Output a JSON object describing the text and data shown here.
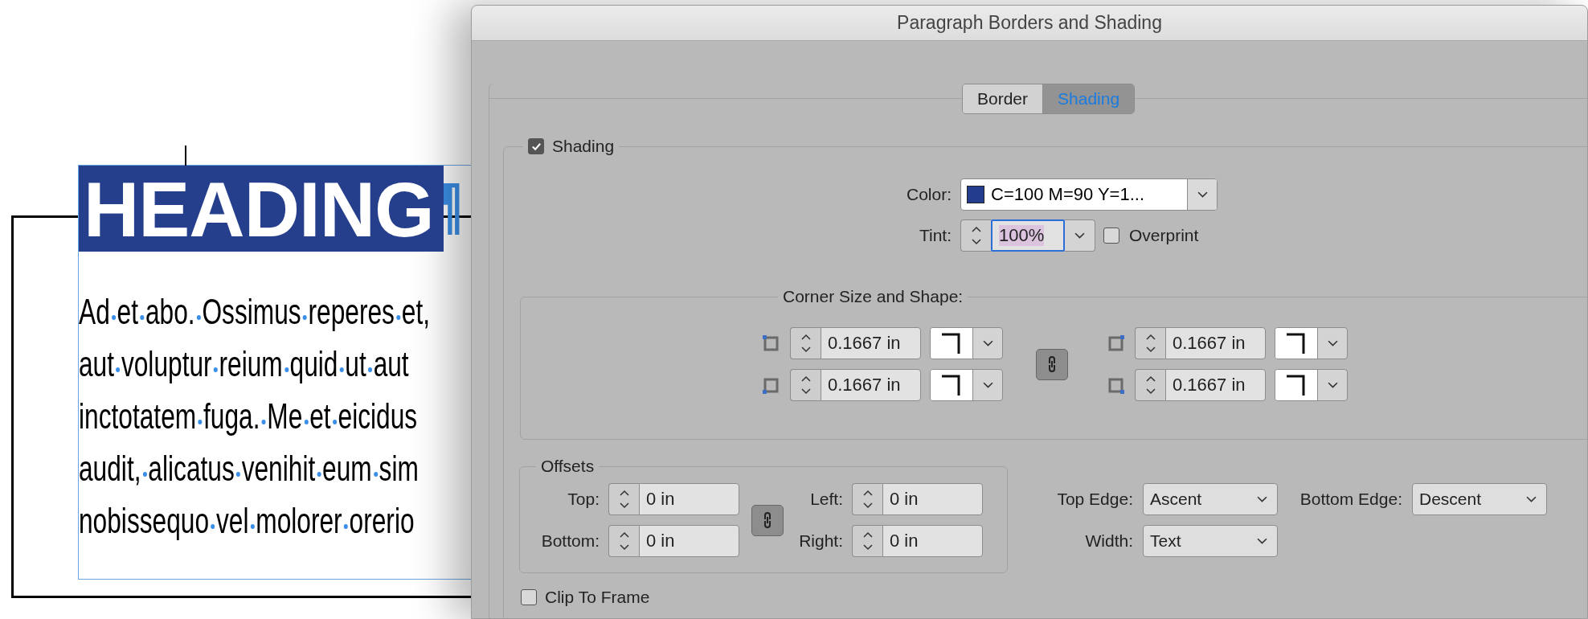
{
  "document": {
    "heading": "HEADING",
    "paragraph_lines": [
      "Ad et abo. Ossimus reperes et,",
      "aut voluptur reium quid ut aut",
      "inctotatem fuga. Me et eicidus",
      "audit, alicatus venihit eum sim",
      "nobissequo vel molorer orerio"
    ]
  },
  "dialog": {
    "title": "Paragraph Borders and Shading",
    "tabs": [
      {
        "label": "Border",
        "selected": false
      },
      {
        "label": "Shading",
        "selected": true
      }
    ],
    "shading": {
      "label": "Shading",
      "checked": true
    },
    "color": {
      "label": "Color:",
      "value": "C=100 M=90 Y=1..."
    },
    "tint": {
      "label": "Tint:",
      "value": "100%"
    },
    "overprint": {
      "label": "Overprint",
      "checked": false
    },
    "corners": {
      "title": "Corner Size and Shape:",
      "items": [
        {
          "kind": "top-left",
          "value": "0.1667 in"
        },
        {
          "kind": "top-right",
          "value": "0.1667 in"
        },
        {
          "kind": "bottom-left",
          "value": "0.1667 in"
        },
        {
          "kind": "bottom-right",
          "value": "0.1667 in"
        }
      ]
    },
    "offsets": {
      "title": "Offsets",
      "fields": [
        {
          "label": "Top:",
          "value": "0 in"
        },
        {
          "label": "Left:",
          "value": "0 in"
        },
        {
          "label": "Bottom:",
          "value": "0 in"
        },
        {
          "label": "Right:",
          "value": "0 in"
        }
      ]
    },
    "edges": [
      {
        "label": "Top Edge:",
        "value": "Ascent"
      },
      {
        "label": "Bottom Edge:",
        "value": "Descent"
      },
      {
        "label": "Width:",
        "value": "Text"
      }
    ],
    "clip_to_frame": {
      "label": "Clip To Frame",
      "checked": false
    }
  }
}
